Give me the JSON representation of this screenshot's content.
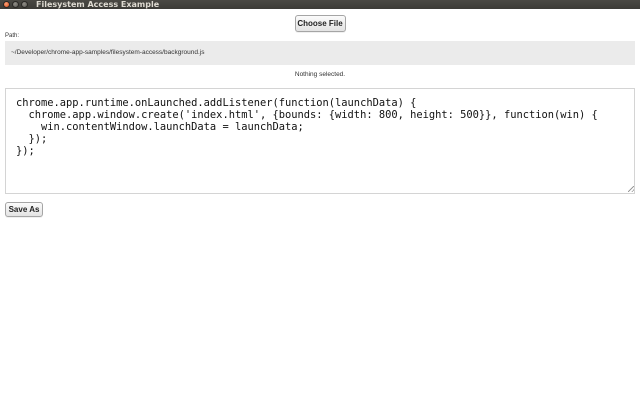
{
  "window": {
    "title": "Filesystem Access Example"
  },
  "toolbar": {
    "choose_file_label": "Choose File"
  },
  "path": {
    "label": "Path:",
    "value": "~/Developer/chrome-app-samples/filesystem-access/background.js"
  },
  "status": {
    "text": "Nothing selected."
  },
  "editor": {
    "content": "chrome.app.runtime.onLaunched.addListener(function(launchData) {\n  chrome.app.window.create('index.html', {bounds: {width: 800, height: 500}}, function(win) {\n    win.contentWindow.launchData = launchData;\n  });\n});"
  },
  "actions": {
    "save_as_label": "Save As"
  },
  "colors": {
    "titlebar": "#3c3b37",
    "close_button": "#df4a16",
    "path_background": "#ebebeb"
  }
}
